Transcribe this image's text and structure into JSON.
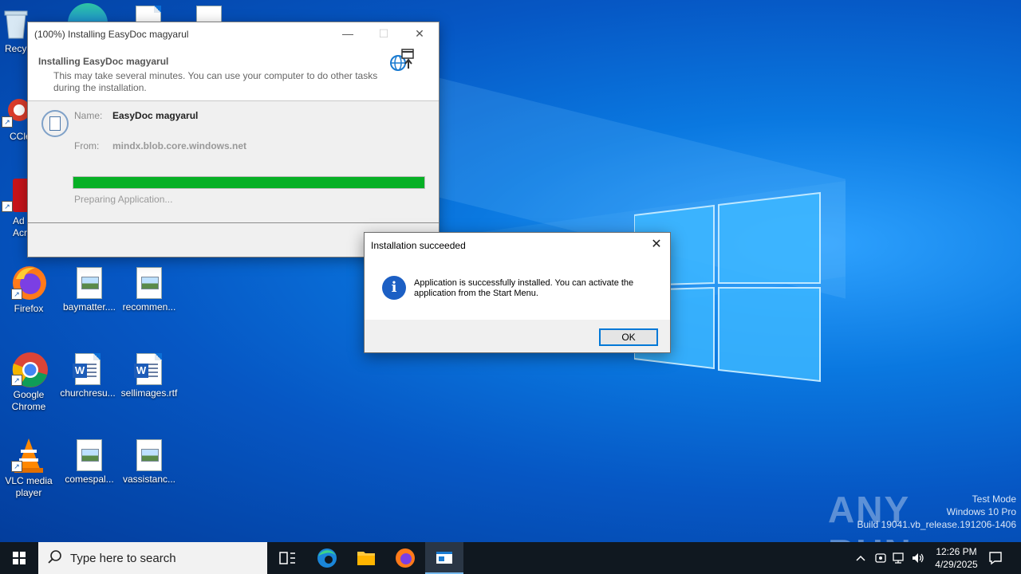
{
  "desktop": {
    "icons": [
      {
        "label": "Recy",
        "kind": "recycle"
      },
      {
        "label": "CCle",
        "kind": "ccleaner"
      },
      {
        "label": "Ad\nAcr",
        "kind": "acrobat"
      },
      {
        "label": "Firefox",
        "kind": "firefox"
      },
      {
        "label": "baymatter....",
        "kind": "image"
      },
      {
        "label": "recommen...",
        "kind": "image"
      },
      {
        "label": "Google\nChrome",
        "kind": "chrome"
      },
      {
        "label": "churchresu...",
        "kind": "word"
      },
      {
        "label": "sellimages.rtf",
        "kind": "word"
      },
      {
        "label": "VLC media\nplayer",
        "kind": "vlc"
      },
      {
        "label": "comespal...",
        "kind": "image"
      },
      {
        "label": "vassistanc...",
        "kind": "image"
      }
    ]
  },
  "installer": {
    "window_title": "(100%) Installing EasyDoc magyarul",
    "heading": "Installing EasyDoc magyarul",
    "subheading": "This may take several minutes. You can use your computer to do other tasks during the installation.",
    "name_label": "Name:",
    "name_value": "EasyDoc magyarul",
    "from_label": "From:",
    "from_value": "mindx.blob.core.windows.net",
    "progress_percent": 100,
    "status": "Preparing Application..."
  },
  "dialog": {
    "title": "Installation succeeded",
    "message": "Application is successfully installed. You can activate the application from the Start Menu.",
    "ok_label": "OK"
  },
  "watermark": {
    "brand": "ANY RUN",
    "line1": "Test Mode",
    "line2": "Windows 10 Pro",
    "line3": "Build 19041.vb_release.191206-1406"
  },
  "taskbar": {
    "search_placeholder": "Type here to search",
    "time": "12:26 PM",
    "date": "4/29/2025"
  },
  "colors": {
    "accent": "#0078d7",
    "progress": "#06b025",
    "taskbar": "#101820"
  }
}
